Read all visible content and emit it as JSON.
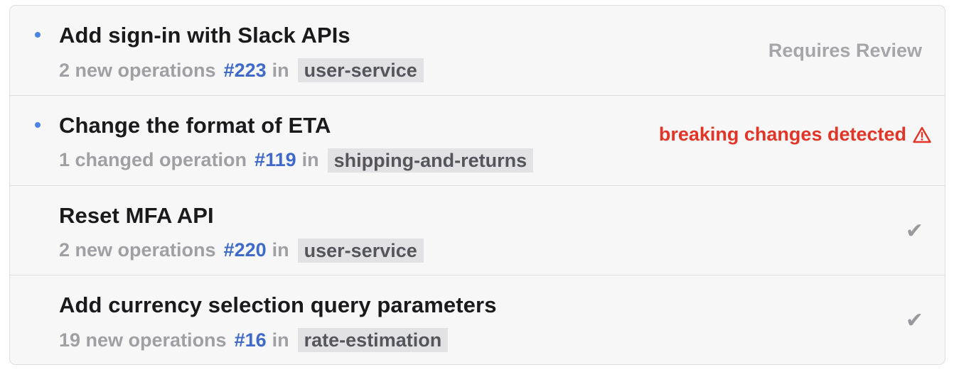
{
  "items": [
    {
      "title": "Add sign-in with Slack APIs",
      "unread": true,
      "count_text": "2 new operations",
      "pr": "#223",
      "in": "in",
      "service": "user-service",
      "status": "Requires Review",
      "status_type": "review"
    },
    {
      "title": "Change the format of ETA",
      "unread": true,
      "count_text": "1 changed operation",
      "pr": "#119",
      "in": "in",
      "service": "shipping-and-returns",
      "status": "breaking changes detected",
      "status_type": "breaking",
      "status_icon": "warning-icon"
    },
    {
      "title": "Reset MFA API",
      "unread": false,
      "count_text": "2 new operations",
      "pr": "#220",
      "in": "in",
      "service": "user-service",
      "status": "✔",
      "status_type": "approved",
      "status_icon": "checkmark-icon"
    },
    {
      "title": "Add currency selection query parameters",
      "unread": false,
      "count_text": "19 new operations",
      "pr": "#16",
      "in": "in",
      "service": "rate-estimation",
      "status": "✔",
      "status_type": "approved",
      "status_icon": "checkmark-icon"
    }
  ],
  "colors": {
    "unread_dot": "#4a84e6",
    "pr_link": "#3f6ac9",
    "breaking": "#e23527",
    "muted": "#a0a0a4"
  }
}
